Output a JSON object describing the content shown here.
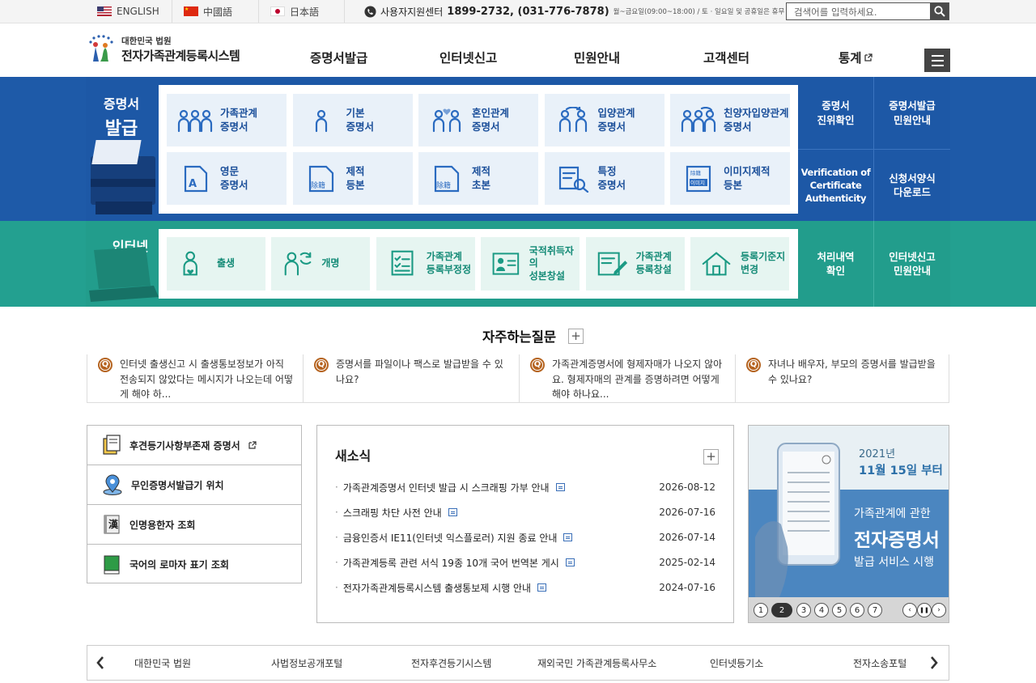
{
  "topbar": {
    "languages": [
      {
        "label": "ENGLISH",
        "flag": "us-flag-icon"
      },
      {
        "label": "中國語",
        "flag": "china-flag-icon"
      },
      {
        "label": "日本語",
        "flag": "japan-flag-icon"
      }
    ],
    "help_label": "사용자지원센터",
    "help_phone": "1899-2732, (031-776-7878)",
    "help_hours": "월~금요일(09:00~18:00) / 토 · 일요일 및 공휴일은 휴무",
    "search_placeholder": "검색어를 입력하세요."
  },
  "logo": {
    "line1": "대한민국 법원",
    "line2": "전자가족관계등록시스템"
  },
  "gnb": [
    {
      "label": "증명서발급"
    },
    {
      "label": "인터넷신고"
    },
    {
      "label": "민원안내"
    },
    {
      "label": "고객센터"
    },
    {
      "label": "통계"
    }
  ],
  "certificate": {
    "label_top": "증명서",
    "label_bottom": "발급",
    "cards": [
      {
        "line1": "가족관계",
        "line2": "증명서",
        "icon": "family-icon"
      },
      {
        "line1": "기본",
        "line2": "증명서",
        "icon": "person-icon"
      },
      {
        "line1": "혼인관계",
        "line2": "증명서",
        "icon": "couple-heart-icon"
      },
      {
        "line1": "입양관계",
        "line2": "증명서",
        "icon": "adoption-icon"
      },
      {
        "line1": "친양자입양관계",
        "line2": "증명서",
        "icon": "family-adoption-icon"
      },
      {
        "line1": "영문",
        "line2": "증명서",
        "icon": "english-document-icon"
      },
      {
        "line1": "제적",
        "line2": "등본",
        "icon": "removed-register-icon"
      },
      {
        "line1": "제적",
        "line2": "초본",
        "icon": "removed-register-excerpt-icon"
      },
      {
        "line1": "특정",
        "line2": "증명서",
        "icon": "document-search-icon"
      },
      {
        "line1": "이미지제적",
        "line2": "등본",
        "icon": "image-register-icon"
      }
    ],
    "side": [
      {
        "line1": "증명서",
        "line2": "진위확인"
      },
      {
        "line1": "증명서발급",
        "line2": "민원안내"
      },
      {
        "line1": "Verification of",
        "line2": "Certificate",
        "line3": "Authenticity"
      },
      {
        "line1": "신청서양식",
        "line2": "다운로드"
      }
    ]
  },
  "report": {
    "label_top": "인터넷",
    "label_bottom": "신고",
    "cards": [
      {
        "line1": "출생",
        "line2": "",
        "icon": "birth-icon"
      },
      {
        "line1": "개명",
        "line2": "",
        "icon": "rename-icon"
      },
      {
        "line1": "가족관계",
        "line2": "등록부정정",
        "icon": "checklist-icon"
      },
      {
        "line1": "국적취득자의",
        "line2": "성본창설",
        "icon": "id-card-icon"
      },
      {
        "line1": "가족관계",
        "line2": "등록창설",
        "icon": "document-pen-icon"
      },
      {
        "line1": "등록기준지",
        "line2": "변경",
        "icon": "house-icon"
      }
    ],
    "side": [
      {
        "line1": "처리내역",
        "line2": "확인"
      },
      {
        "line1": "인터넷신고",
        "line2": "민원안내"
      }
    ]
  },
  "faq": {
    "title": "자주하는질문",
    "items": [
      {
        "text": "인터넷 출생신고 시 출생통보정보가 아직 전송되지 않았다는 메시지가 나오는데 어떻게 해야 하..."
      },
      {
        "text": "증명서를 파일이나 팩스로 발급받을 수 있나요?"
      },
      {
        "text": "가족관계증명서에 형제자매가 나오지 않아요. 형제자매의 관계를 증명하려면 어떻게 해야 하나요..."
      },
      {
        "text": "자녀나 배우자, 부모의 증명서를 발급받을 수 있나요?"
      }
    ]
  },
  "quick_links": [
    {
      "label": "후견등기사항부존재 증명서",
      "icon": "document-folder-icon"
    },
    {
      "label": "무인증명서발급기 위치",
      "icon": "location-pin-icon"
    },
    {
      "label": "인명용한자 조회",
      "icon": "hanja-book-icon"
    },
    {
      "label": "국어의 로마자 표기 조회",
      "icon": "green-book-icon"
    }
  ],
  "news": {
    "title": "새소식",
    "items": [
      {
        "title": "가족관계증명서 인터넷 발급 시 스크래핑 가부 안내",
        "date": "2026-08-12"
      },
      {
        "title": "스크래핑 차단 사전 안내",
        "date": "2026-07-16"
      },
      {
        "title": "금융인증서 IE11(인터넷 익스플로러) 지원 종료 안내",
        "date": "2026-07-14"
      },
      {
        "title": "가족관계등록 관련 서식 19종 10개 국어 번역본 게시",
        "date": "2025-02-14"
      },
      {
        "title": "전자가족관계등록시스템 출생통보제 시행 안내",
        "date": "2024-07-16"
      }
    ]
  },
  "banner": {
    "year": "2021년",
    "date": "11월 15일 부터",
    "line1": "가족관계에 관한",
    "line2": "전자증명서",
    "line3": "발급 서비스 시행",
    "pages": [
      "1",
      "2",
      "3",
      "4",
      "5",
      "6",
      "7"
    ],
    "active_page": "2"
  },
  "footer_links": [
    {
      "label": "대한민국 법원"
    },
    {
      "label": "사법정보공개포털"
    },
    {
      "label": "전자후견등기시스템"
    },
    {
      "label": "재외국민 가족관계등록사무소"
    },
    {
      "label": "인터넷등기소"
    },
    {
      "label": "전자소송포털"
    }
  ],
  "colors": {
    "blue_band": "#1d58a6",
    "teal_band": "#229d8c",
    "card_blue": "#e9f1f9",
    "card_teal": "#e6f5f1",
    "faq_badge": "#b5631f"
  }
}
